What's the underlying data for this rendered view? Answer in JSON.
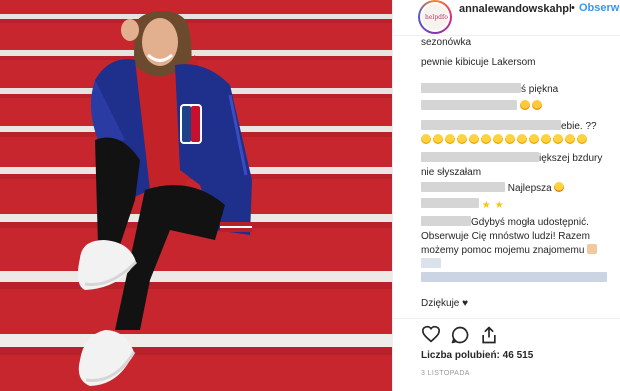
{
  "post": {
    "username": "annalewandowskahpba",
    "separator": "•",
    "follow_label": "Obserwuj",
    "avatar_text": "helpdfod"
  },
  "comments": [
    {
      "text": "sezonówka"
    },
    {
      "text": "pewnie kibicuje Lakersom"
    },
    {
      "text": "ś piękna"
    },
    {
      "text": "ebie. ??"
    },
    {
      "text": "iększej bzdury"
    },
    {
      "text": "nie słyszałam"
    },
    {
      "text": "Najlepsza"
    },
    {
      "text": "Gdybyś mogła udostępnić."
    },
    {
      "text": "Obserwuje Cię mnóstwo ludzi! Razem"
    },
    {
      "text": "możemy pomoc mojemu znajomemu"
    },
    {
      "text": "Dziękuje ♥"
    }
  ],
  "actions": {
    "like_icon": "heart-icon",
    "comment_icon": "comment-icon",
    "share_icon": "share-icon"
  },
  "likes_text": "Liczba polubień: 46 515",
  "date_text": "3 LISTOPADA",
  "colors": {
    "link": "#3897f0",
    "stairs_red": "#c8262e",
    "jacket_blue": "#1f2f8c"
  }
}
